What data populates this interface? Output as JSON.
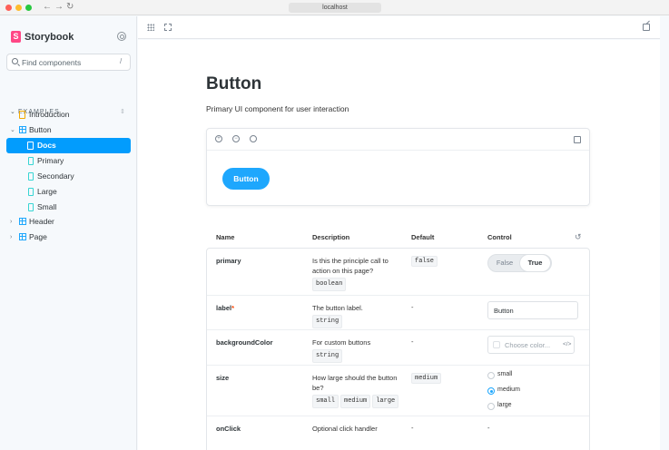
{
  "browser": {
    "url": "localhost",
    "back": "←",
    "forward": "→",
    "reload": "↻"
  },
  "sidebar": {
    "brand": "Storybook",
    "brand_logo": "S",
    "search": {
      "placeholder": "Find components",
      "shortcut": "/"
    },
    "section": "EXAMPLES",
    "items": [
      {
        "label": "Introduction",
        "icon": "doc-icon"
      },
      {
        "label": "Button",
        "icon": "component-icon",
        "expanded": true
      },
      {
        "label": "Docs",
        "icon": "doc-icon",
        "active": true
      },
      {
        "label": "Primary",
        "icon": "story-icon"
      },
      {
        "label": "Secondary",
        "icon": "story-icon"
      },
      {
        "label": "Large",
        "icon": "story-icon"
      },
      {
        "label": "Small",
        "icon": "story-icon"
      },
      {
        "label": "Header",
        "icon": "component-icon"
      },
      {
        "label": "Page",
        "icon": "component-icon"
      }
    ]
  },
  "docs": {
    "title": "Button",
    "subtitle": "Primary UI component for user interaction",
    "preview_button": "Button"
  },
  "args_table": {
    "headers": {
      "name": "Name",
      "description": "Description",
      "default": "Default",
      "control": "Control"
    },
    "rows": [
      {
        "name": "primary",
        "description": "Is this the principle call to action on this page?",
        "type": "boolean",
        "default": "false"
      },
      {
        "name": "label",
        "required": "*",
        "description": "The button label.",
        "type": "string",
        "default": "-",
        "value": "Button"
      },
      {
        "name": "backgroundColor",
        "description": "For custom buttons",
        "type": "string",
        "default": "-",
        "placeholder": "Choose color...",
        "code_icon": "</>"
      },
      {
        "name": "size",
        "description": "How large should the button be?",
        "types": [
          "small",
          "medium",
          "large"
        ],
        "default": "medium"
      },
      {
        "name": "onClick",
        "description": "Optional click handler",
        "default": "-",
        "control": "-"
      }
    ],
    "toggle": {
      "off": "False",
      "on": "True",
      "selected": "True"
    },
    "size_options": [
      "small",
      "medium",
      "large"
    ],
    "size_selected": "medium"
  },
  "colors": {
    "accent": "#029cfd",
    "brand": "#ff4785",
    "button": "#1ea7fd"
  }
}
